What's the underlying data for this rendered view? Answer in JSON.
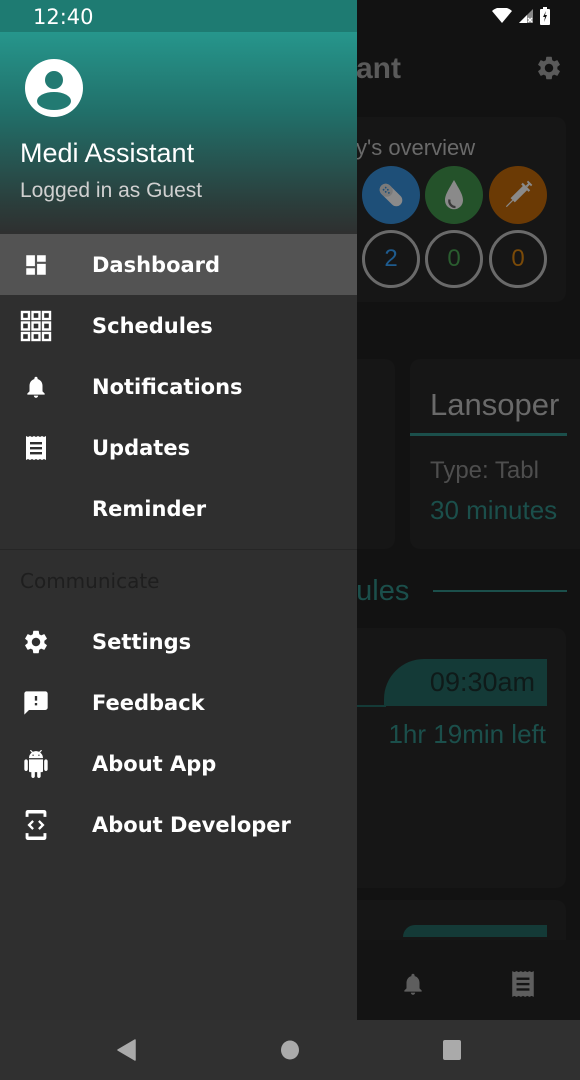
{
  "status_bar": {
    "time": "12:40",
    "icons": [
      "wifi-icon",
      "cell-signal-no-service-icon",
      "battery-charging-icon"
    ]
  },
  "drawer": {
    "header": {
      "avatar_icon": "account-circle-icon",
      "app_name": "Medi Assistant",
      "login_status": "Logged in as Guest"
    },
    "primary_items": [
      {
        "label": "Dashboard",
        "icon": "dashboard-icon",
        "active": true
      },
      {
        "label": "Schedules",
        "icon": "grid-icon",
        "active": false
      },
      {
        "label": "Notifications",
        "icon": "bell-icon",
        "active": false
      },
      {
        "label": "Updates",
        "icon": "receipt-icon",
        "active": false
      },
      {
        "label": "Reminder",
        "icon": "",
        "active": false
      }
    ],
    "section_title": "Communicate",
    "secondary_items": [
      {
        "label": "Settings",
        "icon": "gear-icon"
      },
      {
        "label": "Feedback",
        "icon": "feedback-icon"
      },
      {
        "label": "About App",
        "icon": "android-icon"
      },
      {
        "label": "About Developer",
        "icon": "developer-mode-icon"
      }
    ]
  },
  "background_app": {
    "title_partial": "ant",
    "settings_icon": "gear-icon",
    "overview": {
      "label_partial": "y's overview",
      "categories": [
        {
          "icon": "pill-icon",
          "color": "#1e4f78",
          "count": "2",
          "count_color": "#1e5b8e"
        },
        {
          "icon": "drop-icon",
          "color": "#24522a",
          "count": "0",
          "count_color": "#2a5c2f"
        },
        {
          "icon": "syringe-icon",
          "color": "#6b3a05",
          "count": "0",
          "count_color": "#7a4a08"
        }
      ]
    },
    "medicine_card": {
      "name_partial": "Lansoper",
      "type_partial": "Type:  Tabl",
      "time_partial": "30 minutes"
    },
    "schedules_label_partial": "dules",
    "schedule_card": {
      "time": "09:30am",
      "remaining": "1hr 19min left"
    },
    "bottom_nav_icons": [
      "bell-icon",
      "receipt-icon"
    ]
  },
  "system_nav": {
    "back": "back-icon",
    "home": "home-icon",
    "recents": "recents-icon"
  },
  "colors": {
    "accent": "#26968c",
    "drawer_bg": "#2f2f2f",
    "active_item_bg": "#535353"
  }
}
